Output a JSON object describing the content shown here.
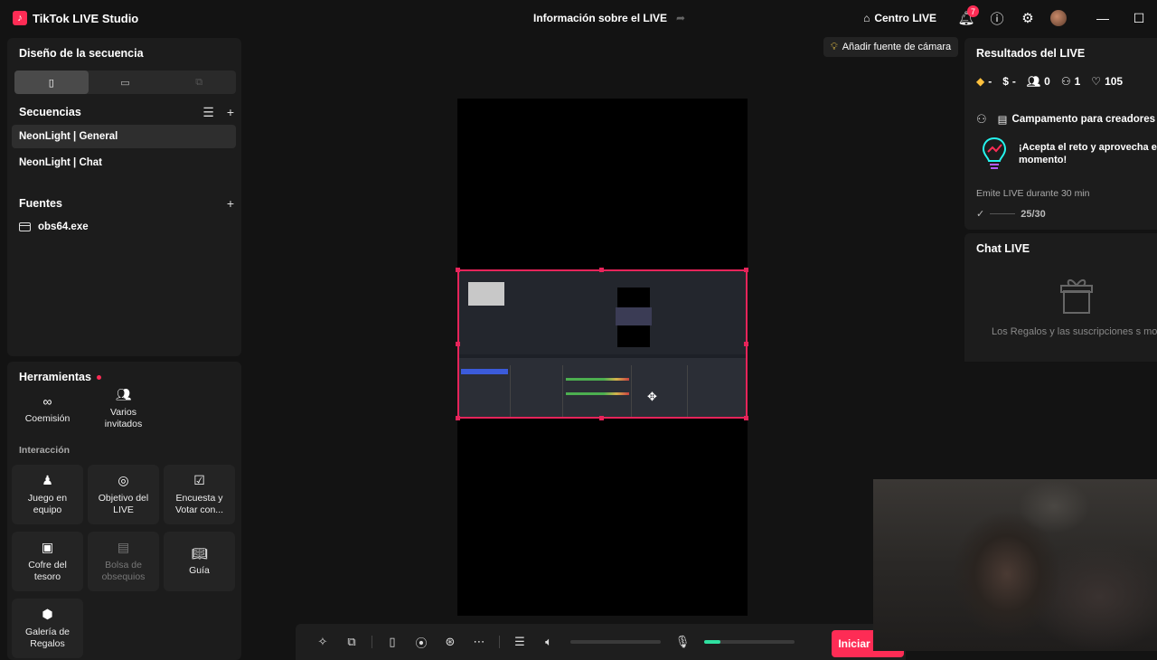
{
  "app": {
    "title": "TikTok LIVE Studio",
    "logo": "tiktok-logo"
  },
  "header": {
    "live_info": "Información sobre el LIVE",
    "centro": "Centro LIVE",
    "notifications": "7"
  },
  "layout": {
    "title": "Diseño de la secuencia"
  },
  "sequences": {
    "title": "Secuencias",
    "items": [
      "NeonLight | General",
      "NeonLight | Chat"
    ]
  },
  "sources": {
    "title": "Fuentes",
    "items": [
      "obs64.exe"
    ]
  },
  "tools": {
    "title": "Herramientas",
    "top": [
      "Coemisión",
      "Varios\ninvitados"
    ],
    "interaction_label": "Interacción",
    "items": [
      "Juego en equipo",
      "Objetivo del LIVE",
      "Encuesta y Votar con...",
      "Cofre del tesoro",
      "Bolsa de obsequios",
      "Guía",
      "Galería de Regalos"
    ]
  },
  "canvas": {
    "camera_button": "Añadir fuente de cámara"
  },
  "bottom": {
    "go_live": "Iniciar LIVE",
    "mic_level": 0.18
  },
  "results": {
    "title": "Resultados del LIVE",
    "gems": "-",
    "coins": "-",
    "viewers": "0",
    "followers": "1",
    "likes": "105",
    "campaign": "Campamento para creadores",
    "challenge": "¡Acepta el reto y aprovecha e momento!",
    "task": "Emite LIVE durante 30 min",
    "progress": "25/30"
  },
  "chat": {
    "title": "Chat LIVE",
    "empty": "Los Regalos y las suscripciones s mostrarán aquí"
  },
  "colors": {
    "accent": "#fe2c55",
    "bg": "#131313",
    "panel": "#1c1c1c"
  }
}
